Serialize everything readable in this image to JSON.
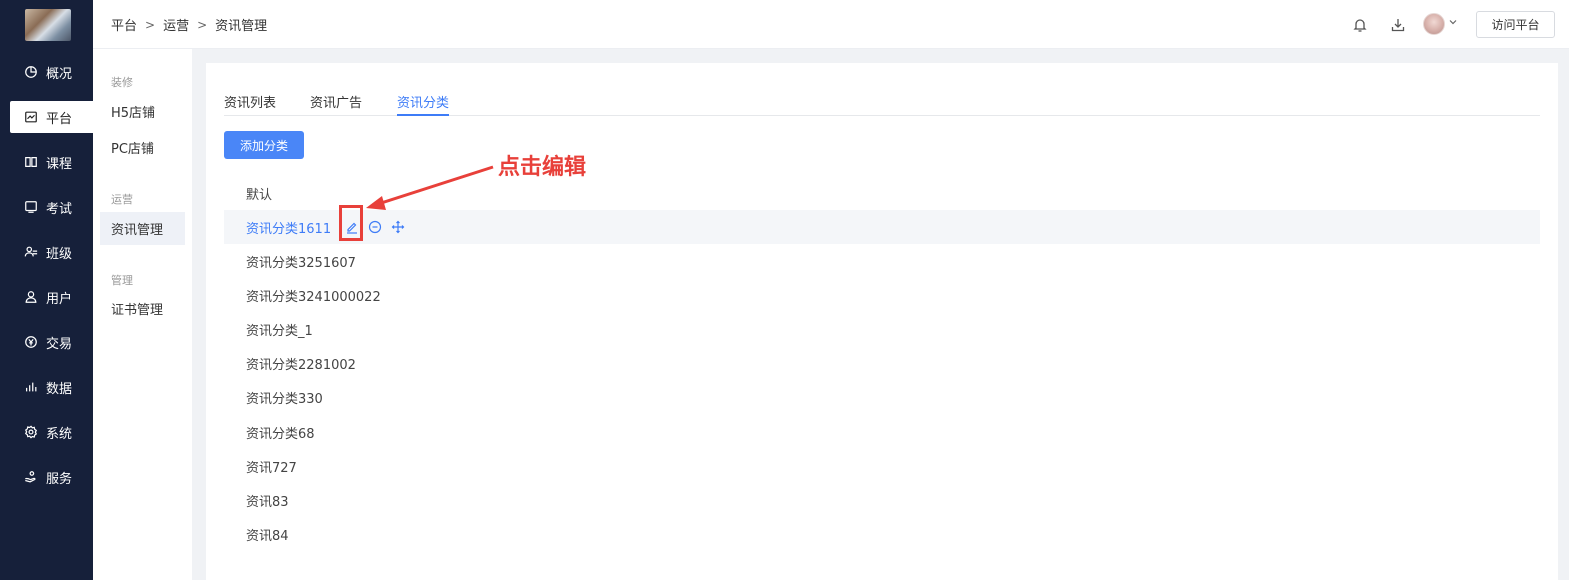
{
  "nav": {
    "items": [
      {
        "label": "概况",
        "icon": "pie-chart-icon"
      },
      {
        "label": "平台",
        "icon": "platform-icon"
      },
      {
        "label": "课程",
        "icon": "book-icon"
      },
      {
        "label": "考试",
        "icon": "exam-icon"
      },
      {
        "label": "班级",
        "icon": "class-icon"
      },
      {
        "label": "用户",
        "icon": "user-icon"
      },
      {
        "label": "交易",
        "icon": "yen-icon"
      },
      {
        "label": "数据",
        "icon": "bar-chart-icon"
      },
      {
        "label": "系统",
        "icon": "gear-icon"
      },
      {
        "label": "服务",
        "icon": "service-icon"
      }
    ]
  },
  "subnav": {
    "groups": [
      {
        "title": "装修",
        "items": [
          "H5店铺",
          "PC店铺"
        ]
      },
      {
        "title": "运营",
        "items": [
          "资讯管理"
        ]
      },
      {
        "title": "管理",
        "items": [
          "证书管理"
        ]
      }
    ]
  },
  "header": {
    "breadcrumb": [
      "平台",
      "运营",
      "资讯管理"
    ],
    "visit_button": "访问平台"
  },
  "main": {
    "tabs": [
      "资讯列表",
      "资讯广告",
      "资讯分类"
    ],
    "active_tab": "资讯分类",
    "add_button": "添加分类",
    "categories": [
      "默认",
      "资讯分类1611",
      "资讯分类3251607",
      "资讯分类3241000022",
      "资讯分类_1",
      "资讯分类2281002",
      "资讯分类330",
      "资讯分类68",
      "资讯727",
      "资讯83",
      "资讯84"
    ]
  },
  "annotation": {
    "text": "点击编辑"
  },
  "colors": {
    "accent": "#3e7cf7",
    "nav_bg": "#16203a",
    "annotation": "#e8403a"
  }
}
